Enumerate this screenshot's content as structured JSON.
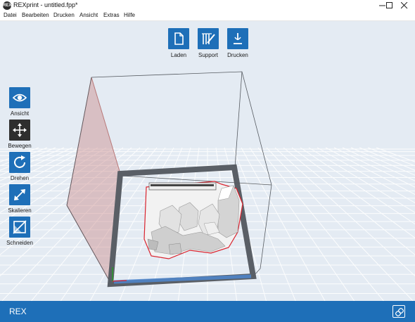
{
  "window": {
    "title": "REXprint - untitled.fpp*",
    "app_icon_text": "REX",
    "controls": [
      "minimize-icon",
      "maximize-icon",
      "close-icon"
    ]
  },
  "menu": {
    "items": [
      "Datei",
      "Bearbeiten",
      "Drucken",
      "Ansicht",
      "Extras",
      "Hilfe"
    ]
  },
  "top_toolbar": {
    "items": [
      {
        "label": "Laden",
        "icon": "load-file-icon"
      },
      {
        "label": "Support",
        "icon": "support-icon"
      },
      {
        "label": "Drucken",
        "icon": "print-icon"
      }
    ]
  },
  "left_toolbar": {
    "items": [
      {
        "label": "Ansicht",
        "icon": "eye-icon",
        "active": false
      },
      {
        "label": "Bewegen",
        "icon": "move-icon",
        "active": true
      },
      {
        "label": "Drehen",
        "icon": "rotate-icon",
        "active": false
      },
      {
        "label": "Skalieren",
        "icon": "scale-icon",
        "active": false
      },
      {
        "label": "Schneiden",
        "icon": "cut-icon",
        "active": false
      }
    ]
  },
  "status_bar": {
    "text": "REX",
    "icon": "link-icon"
  },
  "colors": {
    "accent": "#1e6fb8",
    "active_tool": "#2e2e2e",
    "viewport_bg": "#e4ebf3",
    "model_outline": "#d9232e",
    "side_wall": "#c98a8a"
  }
}
